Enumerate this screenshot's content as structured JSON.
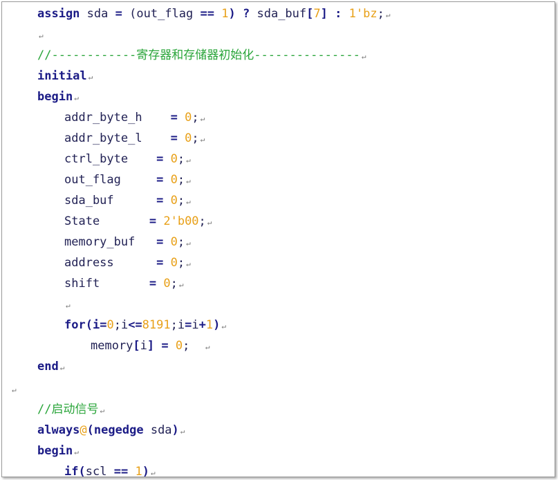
{
  "code": {
    "l1": {
      "kw": "assign",
      "id1": "sda",
      "op1": "=",
      "p1": "(out_flag ",
      "op2": "==",
      "n1": "1",
      "p2": ")",
      "op3": "?",
      "id2": "sda_buf",
      "b1": "[",
      "n2": "7",
      "b2": "]",
      "op4": ":",
      "n3": "1'bz",
      "semi": ";"
    },
    "l3": {
      "comment": "//------------寄存器和存储器初始化---------------"
    },
    "l4": {
      "kw": "initial"
    },
    "l5": {
      "kw": "begin"
    },
    "assigns": [
      {
        "name": "addr_byte_h",
        "pad": "   ",
        "value": "0"
      },
      {
        "name": "addr_byte_l",
        "pad": "   ",
        "value": "0"
      },
      {
        "name": "ctrl_byte",
        "pad": "   ",
        "value": "0"
      },
      {
        "name": "out_flag",
        "pad": "    ",
        "value": "0"
      },
      {
        "name": "sda_buf",
        "pad": "     ",
        "value": "0"
      },
      {
        "name": "State",
        "pad": "      ",
        "value": "2'b00"
      },
      {
        "name": "memory_buf",
        "pad": "  ",
        "value": "0"
      },
      {
        "name": "address",
        "pad": "     ",
        "value": "0"
      },
      {
        "name": "shift",
        "pad": "      ",
        "value": "0"
      }
    ],
    "for_line": {
      "kw": "for",
      "p1": "(i",
      "op1": "=",
      "n1": "0",
      "p2": ";i",
      "op2": "<=",
      "n2": "8191",
      "p3": ";i",
      "op3": "=",
      "p4": "i",
      "op4": "+",
      "n3": "1",
      "p5": ")"
    },
    "mem_line": {
      "id": "memory",
      "b1": "[",
      "idx": "i",
      "b2": "]",
      "op": "=",
      "val": "0",
      "semi": ";"
    },
    "end_line": {
      "kw": "end"
    },
    "comment2": {
      "text": "//启动信号"
    },
    "always_line": {
      "kw": "always",
      "at": "@",
      "p1": "(",
      "kw2": "negedge",
      "id": "sda",
      "p2": ")"
    },
    "begin2": {
      "kw": "begin"
    },
    "if_line": {
      "kw": "if",
      "p1": "(",
      "id": "scl",
      "op": "==",
      "n": "1",
      "p2": ")"
    }
  }
}
